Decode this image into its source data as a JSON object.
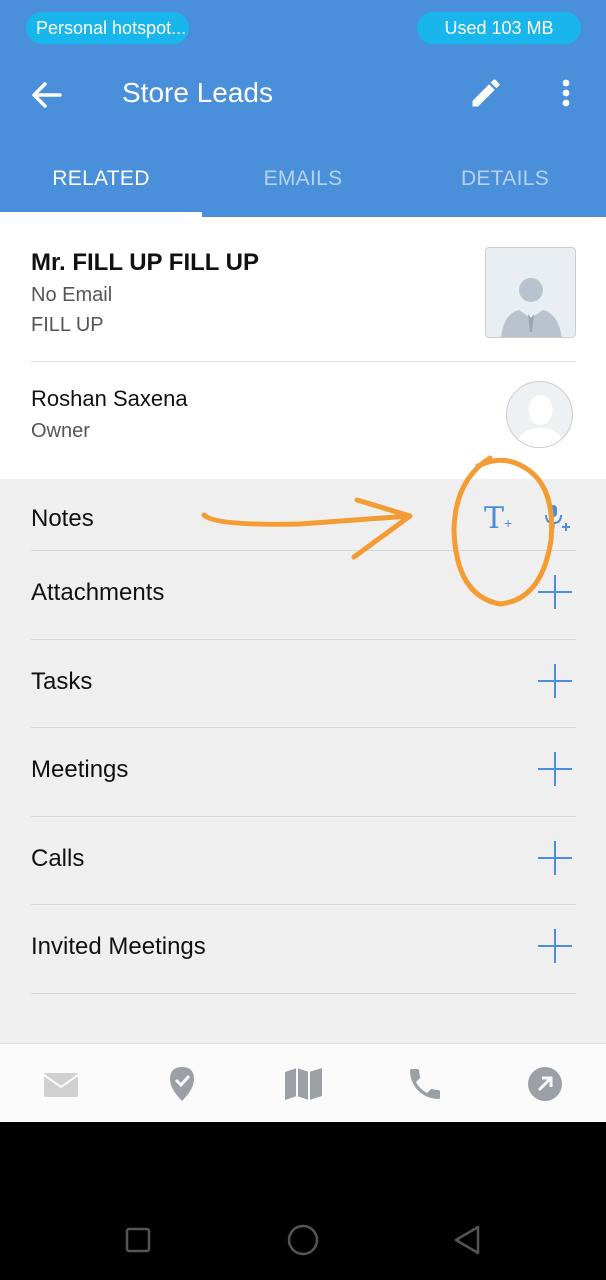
{
  "status_bar": {
    "hotspot_label": "Personal hotspot...",
    "data_usage": "Used  103 MB"
  },
  "app_bar": {
    "title": "Store Leads",
    "icons": {
      "back": "arrow-left-icon",
      "edit": "pencil-icon",
      "more": "more-vertical-icon"
    }
  },
  "tabs": [
    {
      "label": "RELATED",
      "active": true
    },
    {
      "label": "EMAILS",
      "active": false
    },
    {
      "label": "DETAILS",
      "active": false
    }
  ],
  "lead": {
    "name": "Mr. FILL UP FILL UP",
    "email": "No Email",
    "company": "FILL UP"
  },
  "owner": {
    "name": "Roshan Saxena",
    "role": "Owner"
  },
  "related": {
    "notes": {
      "label": "Notes",
      "text_note_icon": "T",
      "text_note_sub": "+"
    },
    "items": [
      {
        "label": "Attachments"
      },
      {
        "label": "Tasks"
      },
      {
        "label": "Meetings"
      },
      {
        "label": "Calls"
      },
      {
        "label": "Invited Meetings"
      }
    ]
  },
  "bottom_nav": [
    {
      "icon": "mail-icon"
    },
    {
      "icon": "checkin-icon"
    },
    {
      "icon": "map-icon"
    },
    {
      "icon": "phone-icon"
    },
    {
      "icon": "share-icon"
    }
  ],
  "colors": {
    "primary": "#4a8fd9",
    "annotation": "#f39c33"
  }
}
